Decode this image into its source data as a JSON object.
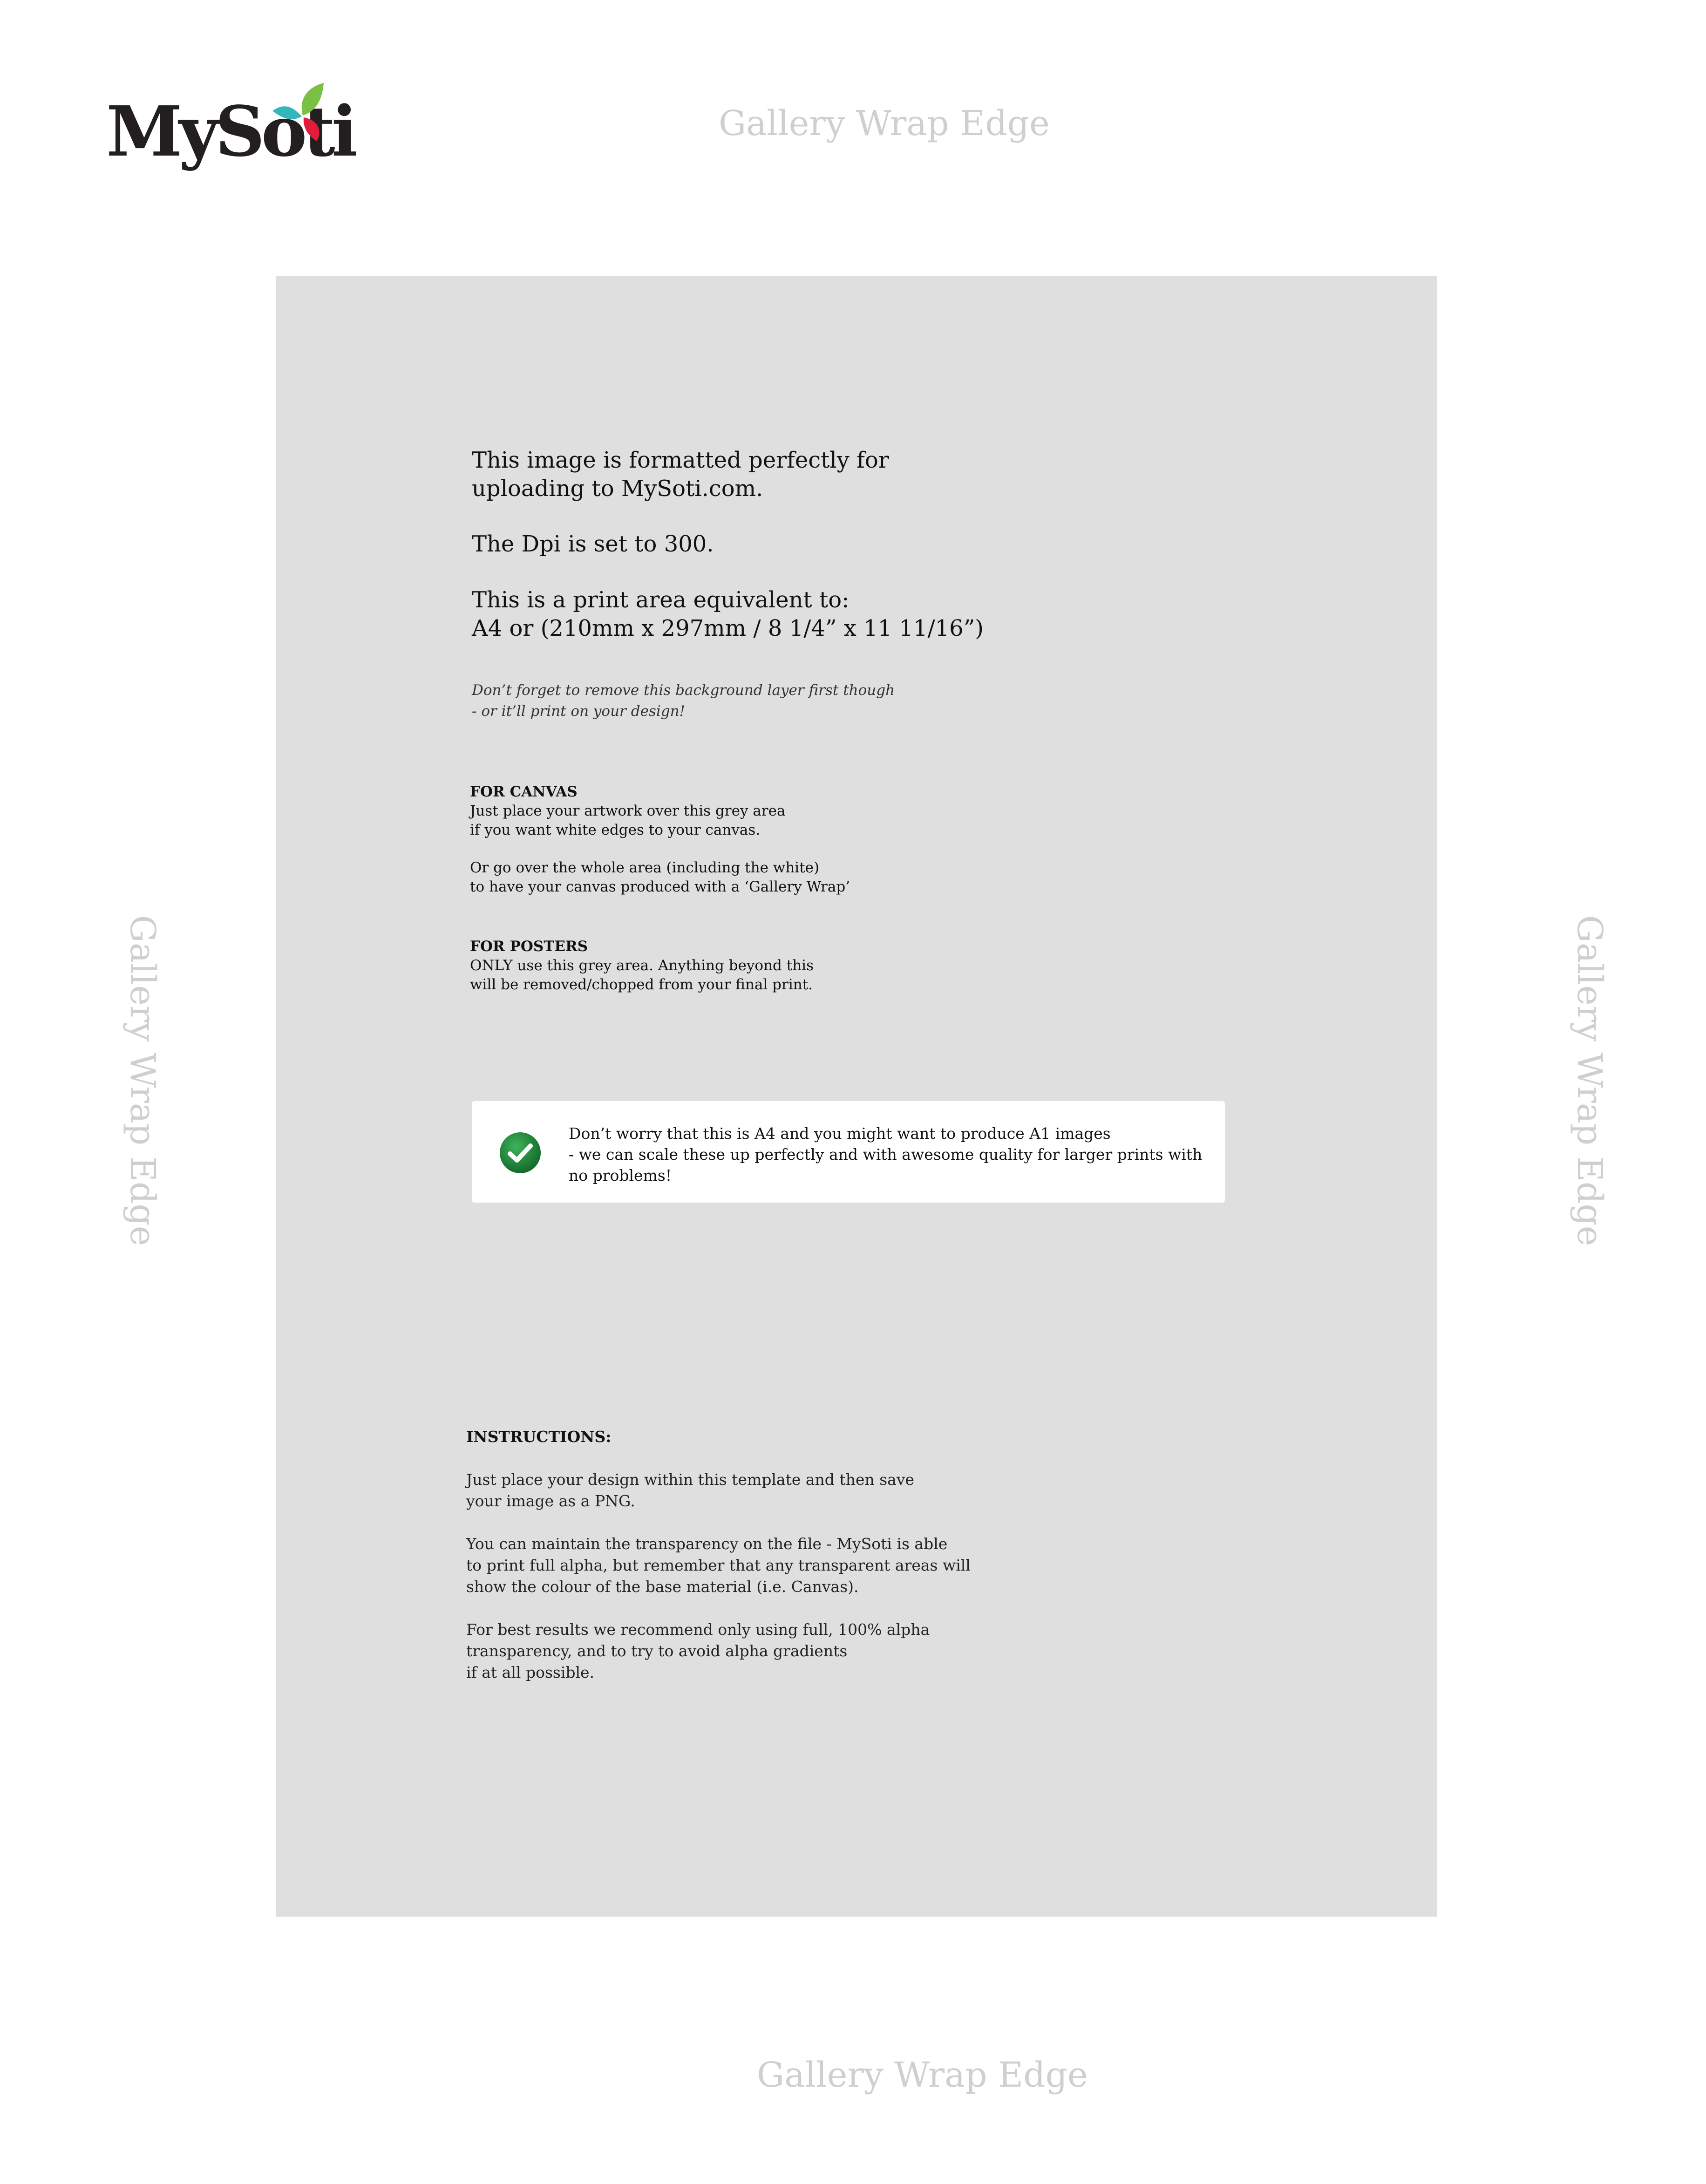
{
  "logo": {
    "text": "MySoti",
    "colors": [
      "#7ac143",
      "#31b7bc",
      "#e21d3c"
    ]
  },
  "edges": {
    "top": "Gallery Wrap Edge",
    "bottom": "Gallery Wrap Edge",
    "left": "Gallery Wrap Edge",
    "right": "Gallery Wrap Edge"
  },
  "intro": {
    "line1": "This image is formatted perfectly for",
    "line2": "uploading to MySoti.com.",
    "dpi": "The Dpi is set to 300.",
    "area1": "This is a print area equivalent to:",
    "area2": "A4 or (210mm x 297mm / 8 1/4” x 11 11/16”)"
  },
  "reminder": {
    "line1": "Don’t forget to remove this background layer first though",
    "line2": "- or it’ll print on your design!"
  },
  "canvas": {
    "heading": "FOR CANVAS",
    "line1": "Just place your artwork over this grey area",
    "line2": "if you want white edges to your canvas.",
    "line3": "Or go over the whole area (including the white)",
    "line4": "to have your canvas produced with a ‘Gallery Wrap’"
  },
  "posters": {
    "heading": "FOR POSTERS",
    "line1": "ONLY use this grey area. Anything beyond this",
    "line2": "will be removed/chopped from your final print."
  },
  "callout": {
    "icon": "check-icon",
    "line1": "Don’t worry that this is A4 and you might want to produce A1 images",
    "line2": "- we can scale these up perfectly and with awesome quality for larger prints with",
    "line3": "no problems!"
  },
  "instructions": {
    "heading": "INSTRUCTIONS:",
    "p1_line1": "Just place your design within this template and then save",
    "p1_line2": "your image as a PNG.",
    "p2_line1": "You can maintain the transparency on the file - MySoti is able",
    "p2_line2": "to print full alpha, but remember that any transparent areas will",
    "p2_line3": "show the colour of the base material (i.e. Canvas).",
    "p3_line1": "For best results we recommend only using full, 100% alpha",
    "p3_line2": "transparency, and to try to avoid alpha gradients",
    "p3_line3": "if at all possible."
  },
  "colors": {
    "print_area": "#dfdfdf",
    "edge_label": "#cfcfcf",
    "check_green": "#1e8a3a"
  }
}
